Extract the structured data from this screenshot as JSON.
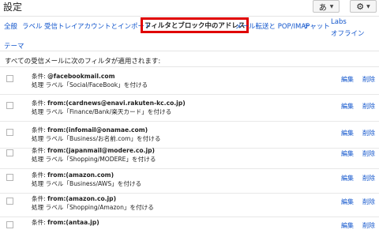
{
  "header": {
    "title": "設定",
    "lang_button": "あ"
  },
  "tabs": [
    {
      "label": "全般"
    },
    {
      "label": "ラベル"
    },
    {
      "label": "受信トレイ"
    },
    {
      "label": "アカウントとインポート"
    },
    {
      "label": "フィルタとブロック中のアドレス"
    },
    {
      "label": "メール転送と POP/IMAP"
    },
    {
      "label": "チャット"
    },
    {
      "label_line1": "Labs",
      "label_line2": "オフライン"
    },
    {
      "label": "テーマ"
    }
  ],
  "intro": "すべての受信メールに次のフィルタが適用されます:",
  "filters": [
    {
      "cond_label": "条件:",
      "cond": "@facebookmail.com",
      "action_label": "処理",
      "action": "ラベル「Social/FaceBook」を付ける",
      "edit": "編集",
      "delete": "削除"
    },
    {
      "cond_label": "条件:",
      "cond": "from:(cardnews@enavi.rakuten-kc.co.jp)",
      "action_label": "処理",
      "action": "ラベル「Finance/Bank/楽天カード」を付ける",
      "edit": "編集",
      "delete": "削除"
    },
    {
      "cond_label": "条件:",
      "cond": "from:(infomail@onamae.com)",
      "action_label": "処理",
      "action": "ラベル「Business/お名前.com」を付ける",
      "edit": "編集",
      "delete": "削除"
    },
    {
      "cond_label": "条件:",
      "cond": "from:(japanmail@modere.co.jp)",
      "action_label": "処理",
      "action": "ラベル「Shopping/MODERE」を付ける",
      "edit": "編集",
      "delete": "削除"
    },
    {
      "cond_label": "条件:",
      "cond": "from:(amazon.com)",
      "action_label": "処理",
      "action": "ラベル「Business/AWS」を付ける",
      "edit": "編集",
      "delete": "削除"
    },
    {
      "cond_label": "条件:",
      "cond": "from:(amazon.co.jp)",
      "action_label": "処理",
      "action": "ラベル「Shopping/Amazon」を付ける",
      "edit": "編集",
      "delete": "削除"
    },
    {
      "cond_label": "条件:",
      "cond": "from:(antaa.jp)",
      "action_label": "",
      "action": "",
      "edit": "編集",
      "delete": "削除"
    }
  ]
}
